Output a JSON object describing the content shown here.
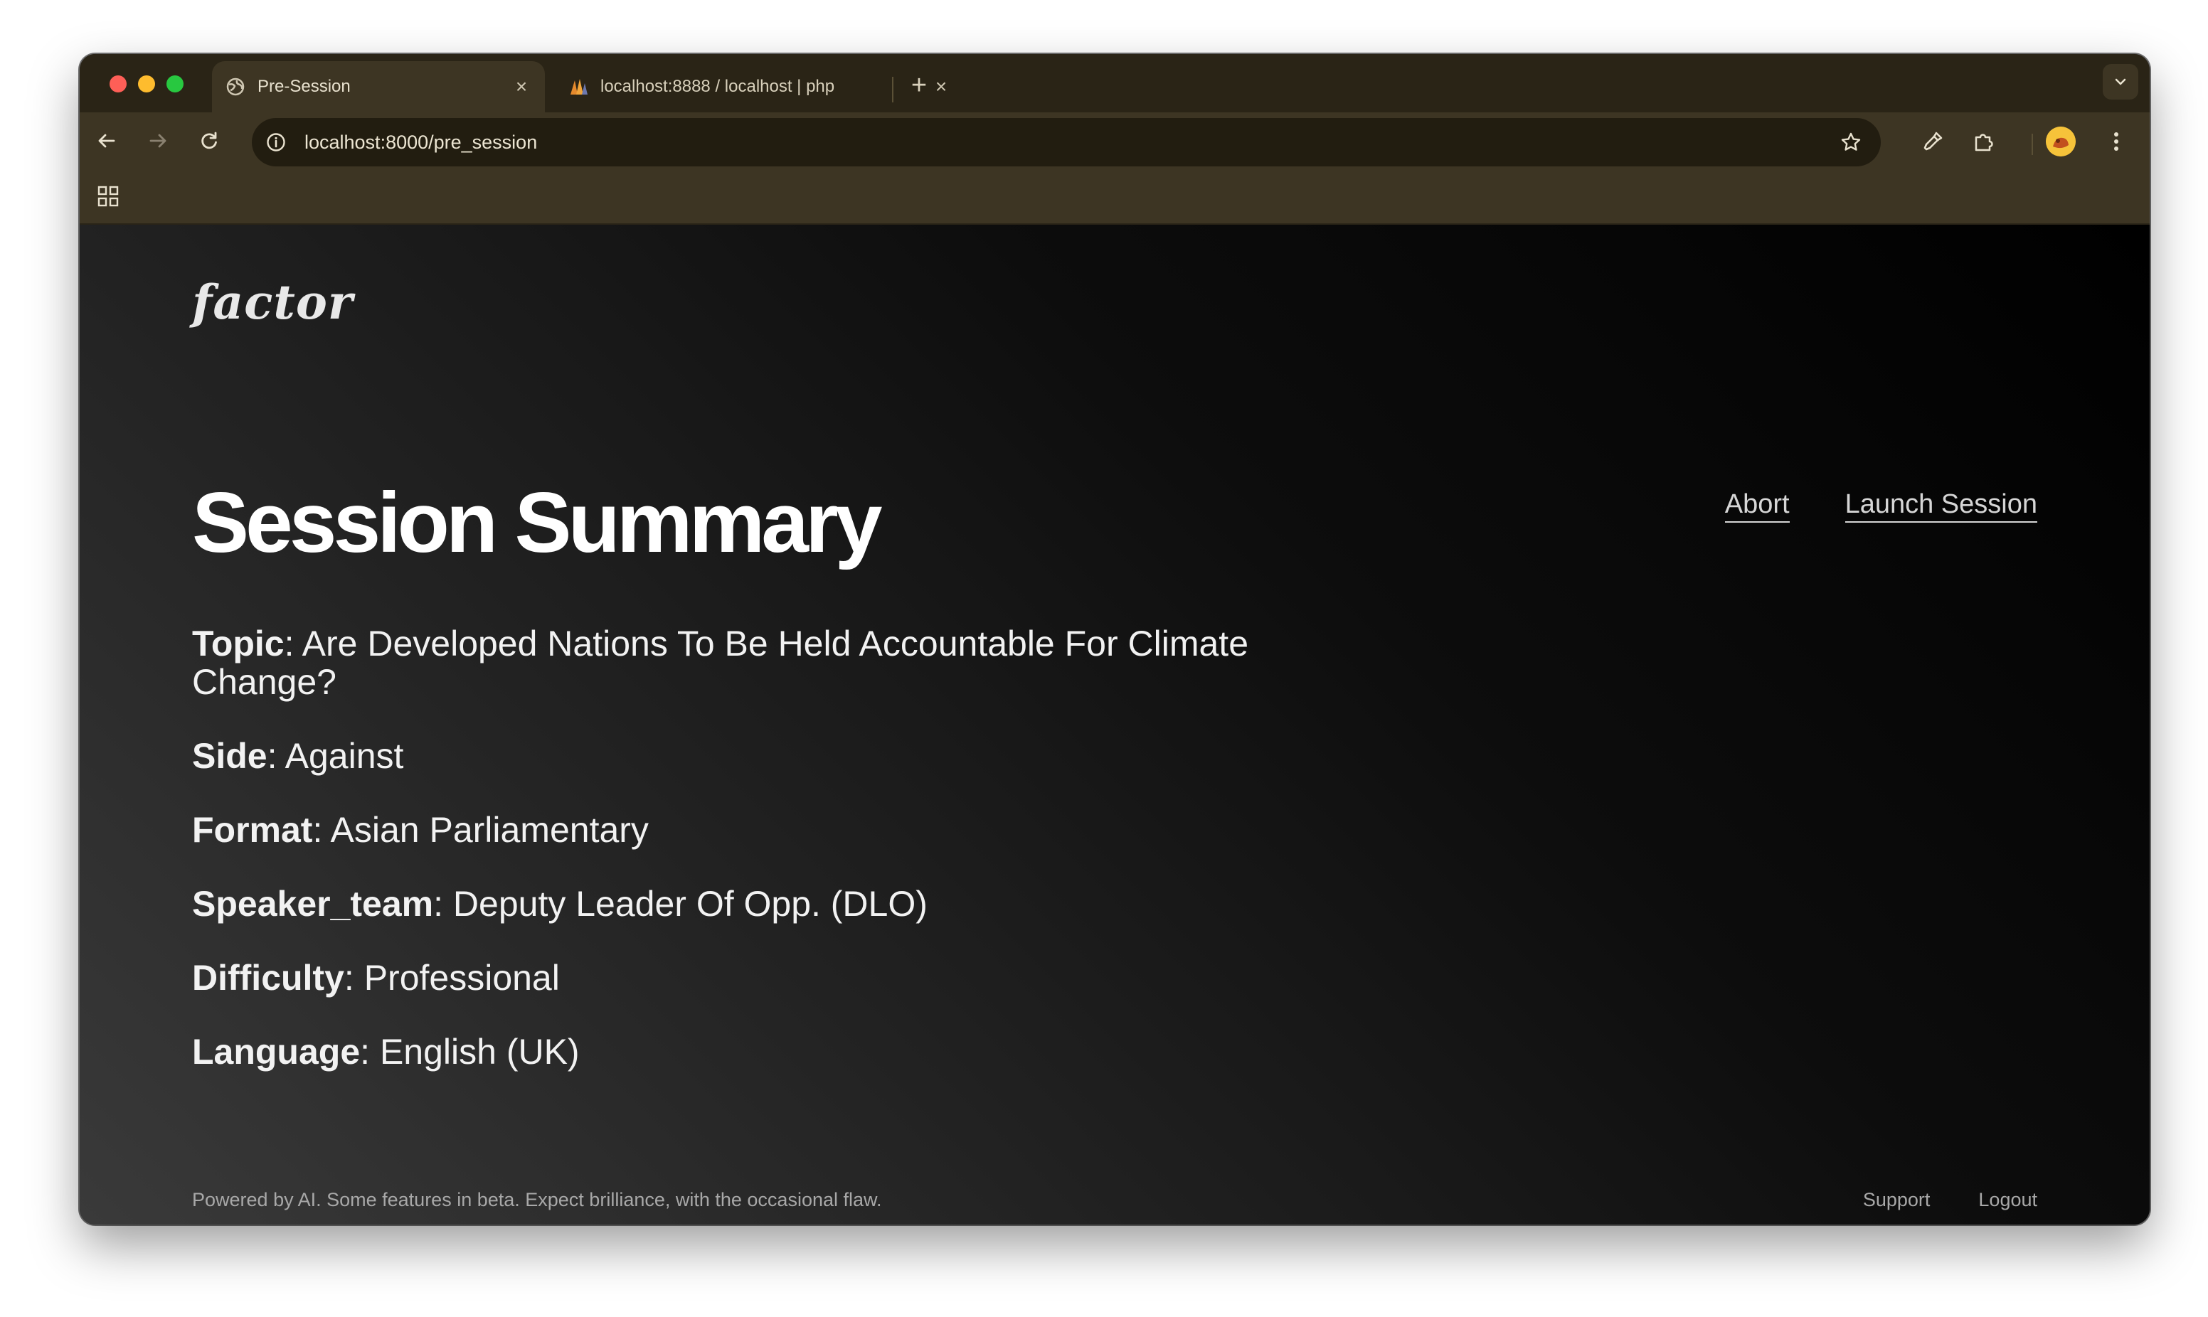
{
  "browser": {
    "tabs": [
      {
        "title": "Pre-Session",
        "favicon": "globe-icon",
        "active": true
      },
      {
        "title": "localhost:8888 / localhost | php",
        "favicon": "phpmyadmin-icon",
        "active": false
      }
    ],
    "url": "localhost:8000/pre_session",
    "colors": {
      "frame": "#2a2416",
      "toolbar": "#3d3523",
      "omnibox": "#221d10"
    }
  },
  "app": {
    "logo": "factor",
    "title": "Session Summary",
    "actions": {
      "abort": "Abort",
      "launch": "Launch Session"
    },
    "fields": [
      {
        "label": "Topic",
        "value": "Are Developed Nations To Be Held Accountable For Climate Change?"
      },
      {
        "label": "Side",
        "value": "Against"
      },
      {
        "label": "Format",
        "value": "Asian Parliamentary"
      },
      {
        "label": "Speaker_team",
        "value": "Deputy Leader Of Opp. (DLO)"
      },
      {
        "label": "Difficulty",
        "value": "Professional"
      },
      {
        "label": "Language",
        "value": "English (UK)"
      }
    ],
    "footer": {
      "note": "Powered by AI. Some features in beta. Expect brilliance, with the occasional flaw.",
      "links": {
        "support": "Support",
        "logout": "Logout"
      }
    }
  }
}
